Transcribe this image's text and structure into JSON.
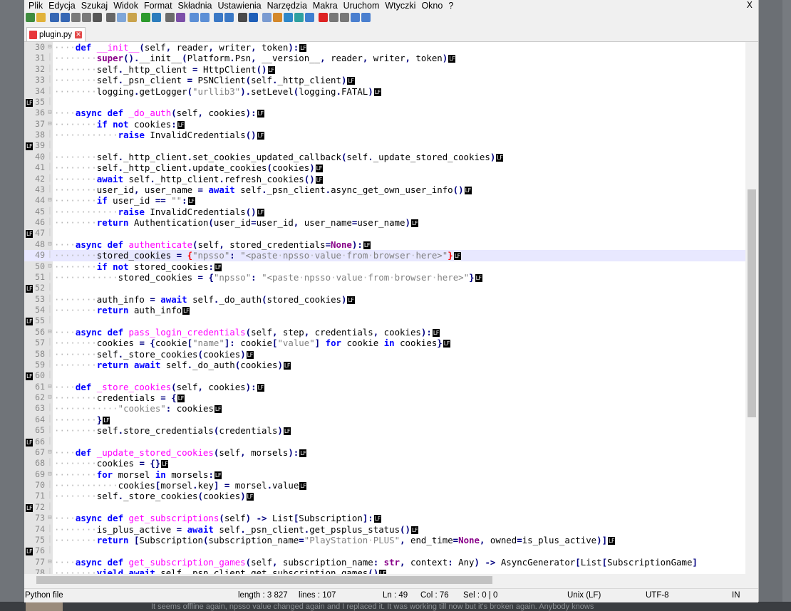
{
  "menu": [
    "Plik",
    "Edycja",
    "Szukaj",
    "Widok",
    "Format",
    "Składnia",
    "Ustawienia",
    "Narzędzia",
    "Makra",
    "Uruchom",
    "Wtyczki",
    "Okno",
    "?"
  ],
  "menu_close": "X",
  "tab": {
    "label": "plugin.py",
    "close": "✕"
  },
  "toolbar_icons": [
    "new-file-icon",
    "open-file-icon",
    "save-icon",
    "save-all-icon",
    "close-icon",
    "close-all-icon",
    "print-icon",
    "cut-icon",
    "copy-icon",
    "paste-icon",
    "undo-icon",
    "redo-icon",
    "find-icon",
    "replace-icon",
    "zoom-in-icon",
    "zoom-out-icon",
    "sync-v-icon",
    "sync-h-icon",
    "wrap-icon",
    "all-chars-icon",
    "indent-guide-icon",
    "udl-icon",
    "doc-map-icon",
    "func-list-icon",
    "monitor-icon",
    "record-macro-icon",
    "stop-macro-icon",
    "play-macro-icon",
    "run-macro-icon",
    "save-macro-icon"
  ],
  "editor": {
    "lf_marker": "LF",
    "current_line": 49,
    "lines": [
      {
        "n": "30",
        "fold": "⊟",
        "html": "····<span class='kw'>def</span> <span class='fn'>__init__</span><span class='op'>(</span>self<span class='op'>,</span> reader<span class='op'>,</span> writer<span class='op'>,</span> token<span class='op'>):</span>"
      },
      {
        "n": "31",
        "fold": "",
        "html": "········<span class='bi'>super</span><span class='op'>().</span>__init__<span class='op'>(</span>Platform<span class='op'>.</span>Psn<span class='op'>,</span> __version__<span class='op'>,</span> reader<span class='op'>,</span> writer<span class='op'>,</span> token<span class='op'>)</span>"
      },
      {
        "n": "32",
        "fold": "",
        "html": "········self<span class='op'>.</span>_http_client <span class='op'>=</span> HttpClient<span class='op'>()</span>"
      },
      {
        "n": "33",
        "fold": "",
        "html": "········self<span class='op'>.</span>_psn_client <span class='op'>=</span> PSNClient<span class='op'>(</span>self<span class='op'>.</span>_http_client<span class='op'>)</span>"
      },
      {
        "n": "34",
        "fold": "",
        "html": "········logging<span class='op'>.</span>getLogger<span class='op'>(</span><span class='st'>\"urllib3\"</span><span class='op'>).</span>setLevel<span class='op'>(</span>logging<span class='op'>.</span>FATAL<span class='op'>)</span>"
      },
      {
        "n": "35",
        "fold": "",
        "html": "",
        "lfpos": "left"
      },
      {
        "n": "36",
        "fold": "⊟",
        "html": "····<span class='kw'>async</span> <span class='kw'>def</span> <span class='fn'>_do_auth</span><span class='op'>(</span>self<span class='op'>,</span> cookies<span class='op'>):</span>"
      },
      {
        "n": "37",
        "fold": "⊟",
        "html": "········<span class='kw'>if</span> <span class='kw'>not</span> cookies<span class='op'>:</span>"
      },
      {
        "n": "38",
        "fold": "",
        "html": "············<span class='kw'>raise</span> InvalidCredentials<span class='op'>()</span>"
      },
      {
        "n": "39",
        "fold": "",
        "html": "",
        "lfpos": "left"
      },
      {
        "n": "40",
        "fold": "",
        "html": "········self<span class='op'>.</span>_http_client<span class='op'>.</span>set_cookies_updated_callback<span class='op'>(</span>self<span class='op'>.</span>_update_stored_cookies<span class='op'>)</span>"
      },
      {
        "n": "41",
        "fold": "",
        "html": "········self<span class='op'>.</span>_http_client<span class='op'>.</span>update_cookies<span class='op'>(</span>cookies<span class='op'>)</span>"
      },
      {
        "n": "42",
        "fold": "",
        "html": "········<span class='kw'>await</span> self<span class='op'>.</span>_http_client<span class='op'>.</span>refresh_cookies<span class='op'>()</span>"
      },
      {
        "n": "43",
        "fold": "",
        "html": "········user_id<span class='op'>,</span> user_name <span class='op'>=</span> <span class='kw'>await</span> self<span class='op'>.</span>_psn_client<span class='op'>.</span>async_get_own_user_info<span class='op'>()</span>"
      },
      {
        "n": "44",
        "fold": "⊟",
        "html": "········<span class='kw'>if</span> user_id <span class='op'>==</span> <span class='st'>\"\"</span><span class='op'>:</span>"
      },
      {
        "n": "45",
        "fold": "",
        "html": "············<span class='kw'>raise</span> InvalidCredentials<span class='op'>()</span>"
      },
      {
        "n": "46",
        "fold": "",
        "html": "········<span class='kw'>return</span> Authentication<span class='op'>(</span>user_id<span class='op'>=</span>user_id<span class='op'>,</span> user_name<span class='op'>=</span>user_name<span class='op'>)</span>"
      },
      {
        "n": "47",
        "fold": "",
        "html": "",
        "lfpos": "left"
      },
      {
        "n": "48",
        "fold": "⊟",
        "html": "····<span class='kw'>async</span> <span class='kw'>def</span> <span class='fn'>authenticate</span><span class='op'>(</span>self<span class='op'>,</span> stored_credentials<span class='op'>=</span><span class='bi'>None</span><span class='op'>):</span>"
      },
      {
        "n": "49",
        "fold": "",
        "html": "········stored_cookies <span class='op'>=</span> <span class='op' style='color:#ff0000'>{</span><span class='st'>\"npsso\"</span><span class='op'>:</span> <span class='st'>\"&lt;paste·npsso·value·from·browser·here&gt;\"</span><span class='op' style='color:#ff0000'>}</span>"
      },
      {
        "n": "50",
        "fold": "⊟",
        "html": "········<span class='kw'>if</span> <span class='kw'>not</span> stored_cookies<span class='op'>:</span>"
      },
      {
        "n": "51",
        "fold": "",
        "html": "············stored_cookies <span class='op'>=</span> <span class='op'>{</span><span class='st'>\"npsso\"</span><span class='op'>:</span> <span class='st'>\"&lt;paste·npsso·value·from·browser·here&gt;\"</span><span class='op'>}</span>"
      },
      {
        "n": "52",
        "fold": "",
        "html": "",
        "lfpos": "left"
      },
      {
        "n": "53",
        "fold": "",
        "html": "········auth_info <span class='op'>=</span> <span class='kw'>await</span> self<span class='op'>.</span>_do_auth<span class='op'>(</span>stored_cookies<span class='op'>)</span>"
      },
      {
        "n": "54",
        "fold": "",
        "html": "········<span class='kw'>return</span> auth_info"
      },
      {
        "n": "55",
        "fold": "",
        "html": "",
        "lfpos": "left"
      },
      {
        "n": "56",
        "fold": "⊟",
        "html": "····<span class='kw'>async</span> <span class='kw'>def</span> <span class='fn'>pass_login_credentials</span><span class='op'>(</span>self<span class='op'>,</span> step<span class='op'>,</span> credentials<span class='op'>,</span> cookies<span class='op'>):</span>"
      },
      {
        "n": "57",
        "fold": "",
        "html": "········cookies <span class='op'>=</span> <span class='op'>{</span>cookie<span class='op'>[</span><span class='st'>\"name\"</span><span class='op'>]:</span> cookie<span class='op'>[</span><span class='st'>\"value\"</span><span class='op'>]</span> <span class='kw'>for</span> cookie <span class='kw'>in</span> cookies<span class='op'>}</span>"
      },
      {
        "n": "58",
        "fold": "",
        "html": "········self<span class='op'>.</span>_store_cookies<span class='op'>(</span>cookies<span class='op'>)</span>"
      },
      {
        "n": "59",
        "fold": "",
        "html": "········<span class='kw'>return</span> <span class='kw'>await</span> self<span class='op'>.</span>_do_auth<span class='op'>(</span>cookies<span class='op'>)</span>"
      },
      {
        "n": "60",
        "fold": "",
        "html": "",
        "lfpos": "left"
      },
      {
        "n": "61",
        "fold": "⊟",
        "html": "····<span class='kw'>def</span> <span class='fn'>_store_cookies</span><span class='op'>(</span>self<span class='op'>,</span> cookies<span class='op'>):</span>"
      },
      {
        "n": "62",
        "fold": "⊟",
        "html": "········credentials <span class='op'>=</span> <span class='op'>{</span>"
      },
      {
        "n": "63",
        "fold": "",
        "html": "············<span class='st'>\"cookies\"</span><span class='op'>:</span> cookies"
      },
      {
        "n": "64",
        "fold": "",
        "html": "········<span class='op'>}</span>"
      },
      {
        "n": "65",
        "fold": "",
        "html": "········self<span class='op'>.</span>store_credentials<span class='op'>(</span>credentials<span class='op'>)</span>"
      },
      {
        "n": "66",
        "fold": "",
        "html": "",
        "lfpos": "left"
      },
      {
        "n": "67",
        "fold": "⊟",
        "html": "····<span class='kw'>def</span> <span class='fn'>_update_stored_cookies</span><span class='op'>(</span>self<span class='op'>,</span> morsels<span class='op'>):</span>"
      },
      {
        "n": "68",
        "fold": "",
        "html": "········cookies <span class='op'>=</span> <span class='op'>{}</span>"
      },
      {
        "n": "69",
        "fold": "⊟",
        "html": "········<span class='kw'>for</span> morsel <span class='kw'>in</span> morsels<span class='op'>:</span>"
      },
      {
        "n": "70",
        "fold": "",
        "html": "············cookies<span class='op'>[</span>morsel<span class='op'>.</span>key<span class='op'>]</span> <span class='op'>=</span> morsel<span class='op'>.</span>value"
      },
      {
        "n": "71",
        "fold": "",
        "html": "········self<span class='op'>.</span>_store_cookies<span class='op'>(</span>cookies<span class='op'>)</span>"
      },
      {
        "n": "72",
        "fold": "",
        "html": "",
        "lfpos": "left"
      },
      {
        "n": "73",
        "fold": "⊟",
        "html": "····<span class='kw'>async</span> <span class='kw'>def</span> <span class='fn'>get_subscriptions</span><span class='op'>(</span>self<span class='op'>)</span> <span class='op'>-&gt;</span> List<span class='op'>[</span>Subscription<span class='op'>]:</span>"
      },
      {
        "n": "74",
        "fold": "",
        "html": "········is_plus_active <span class='op'>=</span> <span class='kw'>await</span> self<span class='op'>.</span>_psn_client<span class='op'>.</span>get_psplus_status<span class='op'>()</span>"
      },
      {
        "n": "75",
        "fold": "",
        "html": "········<span class='kw'>return</span> <span class='op'>[</span>Subscription<span class='op'>(</span>subscription_name<span class='op'>=</span><span class='st'>\"PlayStation·PLUS\"</span><span class='op'>,</span> end_time<span class='op'>=</span><span class='bi'>None</span><span class='op'>,</span> owned<span class='op'>=</span>is_plus_active<span class='op'>)]</span>"
      },
      {
        "n": "76",
        "fold": "",
        "html": "",
        "lfpos": "left"
      },
      {
        "n": "77",
        "fold": "⊟",
        "html": "····<span class='kw'>async</span> <span class='kw'>def</span> <span class='fn'>get_subscription_games</span><span class='op'>(</span>self<span class='op'>,</span> subscription_name<span class='op'>:</span> <span class='bi'>str</span><span class='op'>,</span> context<span class='op'>:</span> Any<span class='op'>)</span> <span class='op'>-&gt;</span> AsyncGenerator<span class='op'>[</span>List<span class='op'>[</span>SubscriptionGame<span class='op'>]</span>",
        "nolf": true
      },
      {
        "n": "78",
        "fold": "",
        "html": "········<span class='kw'>yield</span> <span class='kw'>await</span> self<span class='op'>.</span>_psn_client<span class='op'>.</span>get_subscription_games<span class='op'>()</span>"
      }
    ]
  },
  "status": {
    "type": "Python file",
    "length": "length : 3 827",
    "lines": "lines : 107",
    "ln": "Ln : 49",
    "col": "Col : 76",
    "sel": "Sel : 0 | 0",
    "eol": "Unix (LF)",
    "encoding": "UTF-8",
    "mode": "IN"
  },
  "background_caption": "It seems offline again, npsso value changed again and I replaced it. It was working till now but it's broken again. Anybody knows"
}
